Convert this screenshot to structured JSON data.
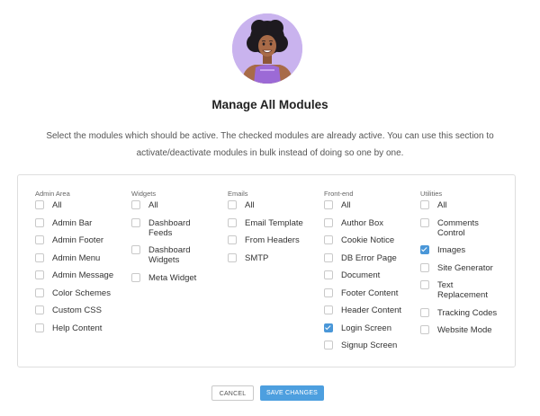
{
  "modal": {
    "title": "Manage All Modules",
    "description": "Select the modules which should be active. The checked modules are already active. You can use this section to activate/deactivate modules in bulk instead of doing so one by one."
  },
  "columns": [
    {
      "heading": "Admin Area",
      "items": [
        {
          "label": "All",
          "checked": false
        },
        {
          "label": "Admin Bar",
          "checked": false
        },
        {
          "label": "Admin Footer",
          "checked": false
        },
        {
          "label": "Admin Menu",
          "checked": false
        },
        {
          "label": "Admin Message",
          "checked": false
        },
        {
          "label": "Color Schemes",
          "checked": false
        },
        {
          "label": "Custom CSS",
          "checked": false
        },
        {
          "label": "Help Content",
          "checked": false
        }
      ]
    },
    {
      "heading": "Widgets",
      "items": [
        {
          "label": "All",
          "checked": false
        },
        {
          "label": "Dashboard Feeds",
          "checked": false
        },
        {
          "label": "Dashboard Widgets",
          "checked": false
        },
        {
          "label": "Meta Widget",
          "checked": false
        }
      ]
    },
    {
      "heading": "Emails",
      "items": [
        {
          "label": "All",
          "checked": false
        },
        {
          "label": "Email Template",
          "checked": false
        },
        {
          "label": "From Headers",
          "checked": false
        },
        {
          "label": "SMTP",
          "checked": false
        }
      ]
    },
    {
      "heading": "Front-end",
      "items": [
        {
          "label": "All",
          "checked": false
        },
        {
          "label": "Author Box",
          "checked": false
        },
        {
          "label": "Cookie Notice",
          "checked": false
        },
        {
          "label": "DB Error Page",
          "checked": false
        },
        {
          "label": "Document",
          "checked": false
        },
        {
          "label": "Footer Content",
          "checked": false
        },
        {
          "label": "Header Content",
          "checked": false
        },
        {
          "label": "Login Screen",
          "checked": true
        },
        {
          "label": "Signup Screen",
          "checked": false
        }
      ]
    },
    {
      "heading": "Utilities",
      "items": [
        {
          "label": "All",
          "checked": false
        },
        {
          "label": "Comments Control",
          "checked": false
        },
        {
          "label": "Images",
          "checked": true
        },
        {
          "label": "Site Generator",
          "checked": false
        },
        {
          "label": "Text Replacement",
          "checked": false
        },
        {
          "label": "Tracking Codes",
          "checked": false
        },
        {
          "label": "Website Mode",
          "checked": false
        }
      ]
    }
  ],
  "buttons": {
    "cancel": "CANCEL",
    "save": "SAVE CHANGES"
  },
  "colors": {
    "accent": "#4a97d8",
    "avatar_bg": "#c9b3ee"
  }
}
